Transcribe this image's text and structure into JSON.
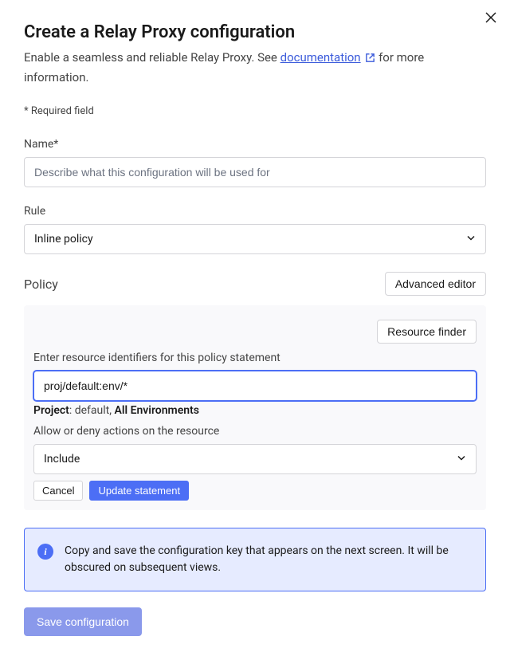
{
  "header": {
    "title": "Create a Relay Proxy configuration",
    "subtitle_prefix": "Enable a seamless and reliable Relay Proxy. See ",
    "doc_link": "documentation",
    "subtitle_suffix": " for more information.",
    "required_note": "* Required field"
  },
  "name_field": {
    "label": "Name*",
    "placeholder": "Describe what this configuration will be used for",
    "value": ""
  },
  "rule_field": {
    "label": "Rule",
    "selected": "Inline policy"
  },
  "policy": {
    "section_label": "Policy",
    "advanced_editor": "Advanced editor",
    "resource_finder": "Resource finder",
    "resource_label": "Enter resource identifiers for this policy statement",
    "resource_value": "proj/default:env/*",
    "resource_desc_prefix": "Project",
    "resource_desc_mid": ": default, ",
    "resource_desc_env": "All Environments",
    "allow_label": "Allow or deny actions on the resource",
    "allow_value": "Include",
    "cancel": "Cancel",
    "update": "Update statement"
  },
  "alert": {
    "text": "Copy and save the configuration key that appears on the next screen. It will be obscured on subsequent views."
  },
  "footer": {
    "save": "Save configuration"
  }
}
